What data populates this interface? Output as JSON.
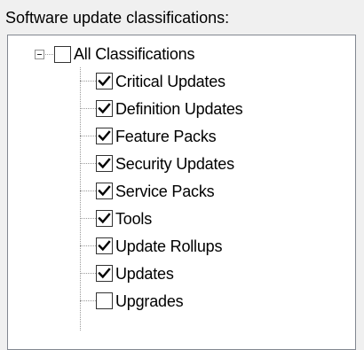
{
  "group_label": "Software update classifications:",
  "tree": {
    "root": {
      "label": "All Classifications",
      "checked": false,
      "expanded": true
    },
    "children": [
      {
        "label": "Critical Updates",
        "checked": true
      },
      {
        "label": "Definition Updates",
        "checked": true
      },
      {
        "label": "Feature Packs",
        "checked": true
      },
      {
        "label": "Security Updates",
        "checked": true
      },
      {
        "label": "Service Packs",
        "checked": true
      },
      {
        "label": "Tools",
        "checked": true
      },
      {
        "label": "Update Rollups",
        "checked": true
      },
      {
        "label": "Updates",
        "checked": true
      },
      {
        "label": "Upgrades",
        "checked": false
      }
    ]
  }
}
